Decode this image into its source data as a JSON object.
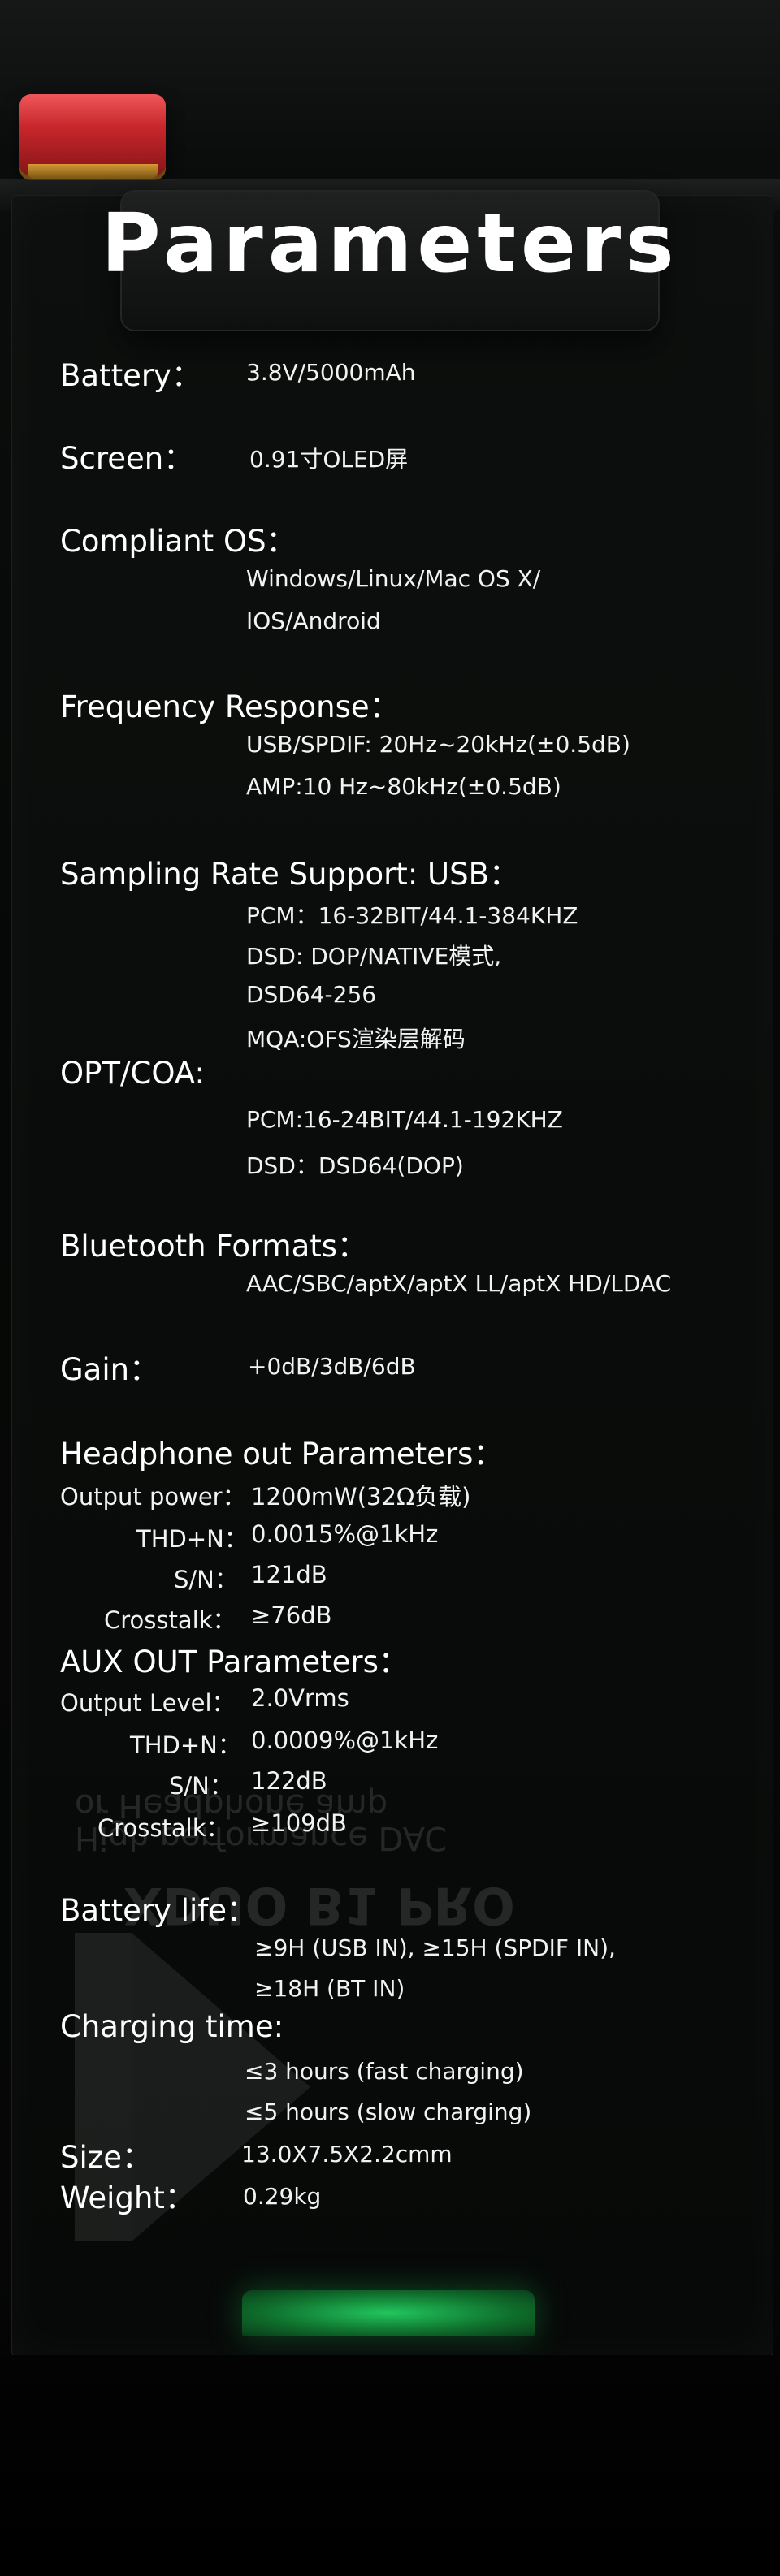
{
  "title": "Parameters",
  "specs": {
    "battery": {
      "label": "Battery：",
      "value": "3.8V/5000mAh"
    },
    "screen": {
      "label": "Screen：",
      "value": "0.91寸OLED屏"
    },
    "os": {
      "label": "Compliant OS：",
      "lines": [
        "Windows/Linux/Mac OS X/",
        "IOS/Android"
      ]
    },
    "freq": {
      "label": "Frequency Response：",
      "lines": [
        "USB/SPDIF: 20Hz~20kHz(±0.5dB)",
        "AMP:10 Hz~80kHz(±0.5dB)"
      ]
    },
    "sampling": {
      "label": "Sampling Rate Support:  USB：",
      "lines": [
        "PCM：16-32BIT/44.1-384KHZ",
        "DSD: DOP/NATIVE模式,",
        "DSD64-256",
        "MQA:OFS渲染层解码"
      ]
    },
    "optcoa": {
      "label": "OPT/COA:",
      "lines": [
        "PCM:16-24BIT/44.1-192KHZ",
        "DSD：DSD64(DOP)"
      ]
    },
    "bluetooth": {
      "label": "Bluetooth Formats：",
      "value": "AAC/SBC/aptX/aptX LL/aptX HD/LDAC"
    },
    "gain": {
      "label": "Gain：",
      "value": "+0dB/3dB/6dB"
    },
    "headphone": {
      "label": "Headphone out Parameters：",
      "rows": [
        {
          "k": "Output power：",
          "v": "1200mW(32Ω负载)"
        },
        {
          "k": "THD+N：",
          "v": "0.0015%@1kHz"
        },
        {
          "k": "S/N：",
          "v": "121dB"
        },
        {
          "k": "Crosstalk：",
          "v": "≥76dB"
        }
      ]
    },
    "aux": {
      "label": "AUX OUT Parameters：",
      "rows": [
        {
          "k": "Output Level：",
          "v": "2.0Vrms"
        },
        {
          "k": "THD+N：",
          "v": "0.0009%@1kHz"
        },
        {
          "k": "S/N：",
          "v": "122dB"
        },
        {
          "k": "Crosstalk：",
          "v": "≥109dB"
        }
      ]
    },
    "battery_life": {
      "label": "Battery life：",
      "lines": [
        "≥9H (USB IN), ≥15H (SPDIF IN),",
        "≥18H (BT IN)"
      ]
    },
    "charging": {
      "label": "Charging time:",
      "lines": [
        "≤3 hours (fast charging)",
        "≤5 hours (slow charging)"
      ]
    },
    "size": {
      "label": "Size：",
      "value": "13.0X7.5X2.2cmm"
    },
    "weight": {
      "label": "Weight：",
      "value": "0.29kg"
    }
  },
  "watermark": {
    "line1": "High performance DAC",
    "line2": "or Headphone amp",
    "line3": "XDUO B1 PRO"
  }
}
